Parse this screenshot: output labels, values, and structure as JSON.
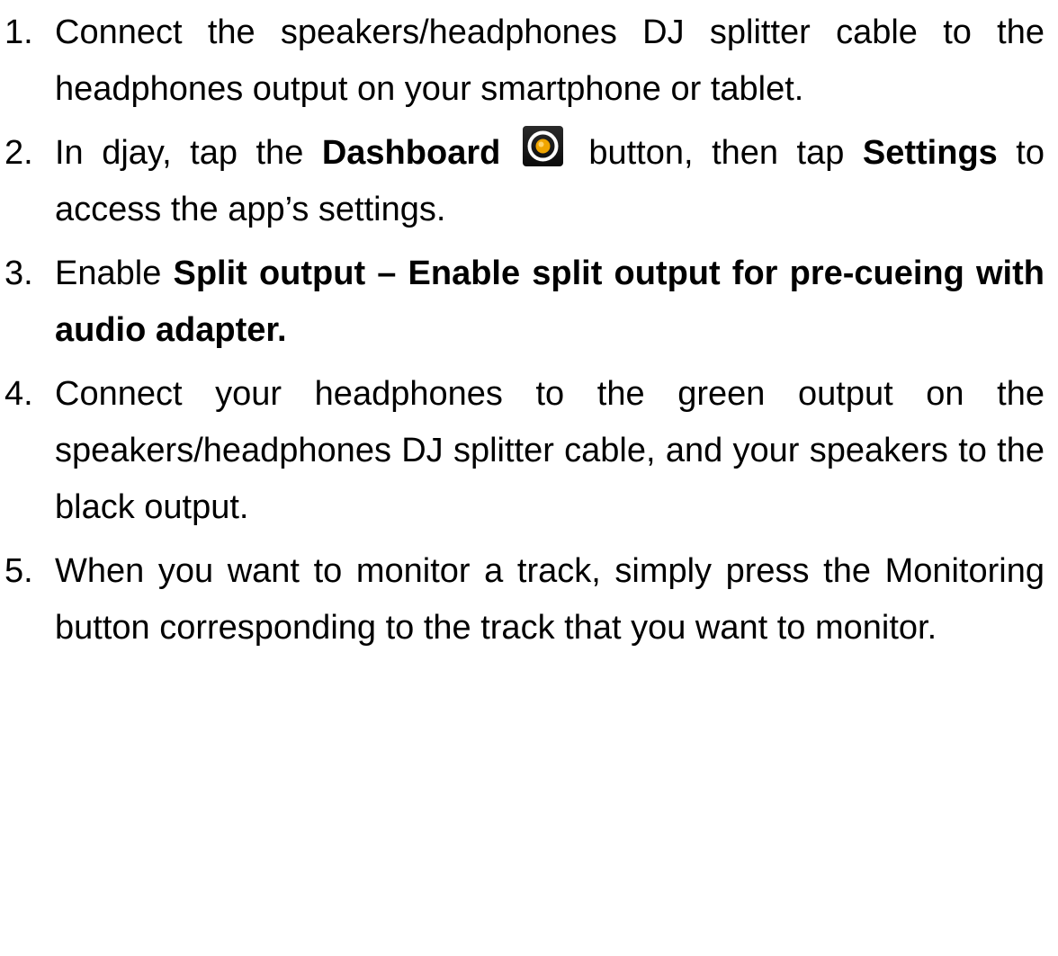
{
  "steps": [
    {
      "number": "1.",
      "text": "Connect the speakers/headphones DJ splitter cable to the headphones output on your smartphone or tablet."
    },
    {
      "number": "2.",
      "pre": "In djay, tap the ",
      "bold1": "Dashboard",
      "icon": "dashboard-button-icon",
      "mid": " button, then tap ",
      "bold2": "Settings",
      "post": " to access the app’s settings."
    },
    {
      "number": "3.",
      "pre": "Enable ",
      "bold": "Split output – Enable split output for pre-cueing with audio adapter."
    },
    {
      "number": "4.",
      "text": "Connect your headphones to the green output on the speakers/headphones DJ splitter cable, and your speakers to the black output."
    },
    {
      "number": "5.",
      "text": "When you want to monitor a track, simply press the Monitoring button corresponding to the track that you want to monitor."
    }
  ],
  "colors": {
    "icon_bg": "#1a1a1a",
    "icon_ring": "#ffffff",
    "icon_center": "#f0a500"
  }
}
